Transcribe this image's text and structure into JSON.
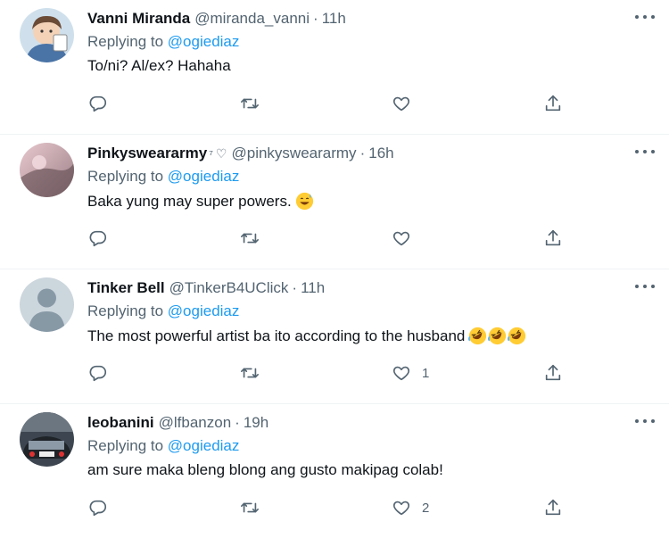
{
  "tweets": [
    {
      "name": "Vanni Miranda",
      "badge": "",
      "handle": "@miranda_vanni",
      "separator": "·",
      "time": "11h",
      "replying_prefix": "Replying to",
      "replying_mention": "@ogiediaz",
      "text": "To/ni? Al/ex? Hahaha",
      "emoji": "",
      "likes": "",
      "avatar_style": "illustration"
    },
    {
      "name": "Pinkysweararmy",
      "badge": "⁷",
      "heart": "♡",
      "handle": "@pinkysweararmy",
      "separator": "·",
      "time": "16h",
      "replying_prefix": "Replying to",
      "replying_mention": "@ogiediaz",
      "text": "Baka yung may super powers.",
      "emoji": "grinning-sweat-emoji",
      "likes": "",
      "avatar_style": "photo-pink"
    },
    {
      "name": "Tinker Bell",
      "badge": "",
      "handle": "@TinkerB4UClick",
      "separator": "·",
      "time": "11h",
      "replying_prefix": "Replying to",
      "replying_mention": "@ogiediaz",
      "text": "The most powerful artist ba ito  according to the husband",
      "emoji": "rolling-laughing-emoji-x3",
      "likes": "1",
      "avatar_style": "default-gray"
    },
    {
      "name": "leobanini",
      "badge": "",
      "handle": "@lfbanzon",
      "separator": "·",
      "time": "19h",
      "replying_prefix": "Replying to",
      "replying_mention": "@ogiediaz",
      "text": "am sure maka bleng blong ang gusto makipag colab!",
      "emoji": "",
      "likes": "2",
      "avatar_style": "photo-car"
    }
  ],
  "icons": {
    "reply": "reply-icon",
    "retweet": "retweet-icon",
    "like": "heart-icon",
    "share": "share-icon",
    "more": "more-icon"
  },
  "colors": {
    "accent": "#1d9bf0",
    "muted": "#536471",
    "divider": "#eff3f4",
    "text": "#0f1419"
  }
}
